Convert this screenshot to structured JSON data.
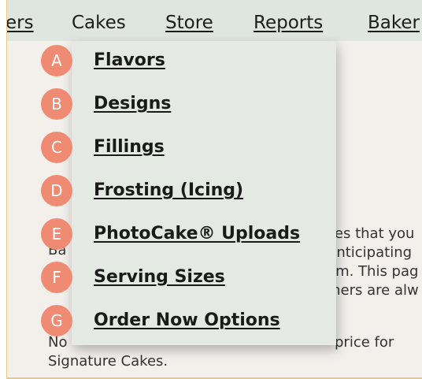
{
  "nav": {
    "items": [
      {
        "label": "ers"
      },
      {
        "label": "Cakes"
      },
      {
        "label": "Store"
      },
      {
        "label": "Reports"
      },
      {
        "label": "Baker"
      }
    ]
  },
  "page": {
    "lines_left": [
      "Ba",
      "",
      "",
      "No",
      "Signature Cakes."
    ],
    "lines_right": [
      "ces that you",
      "Anticipating",
      "em. This pag",
      "mers are alw"
    ],
    "partial_line": "price for"
  },
  "menu": {
    "items": [
      {
        "badge": "A",
        "label": "Flavors"
      },
      {
        "badge": "B",
        "label": "Designs"
      },
      {
        "badge": "C",
        "label": "Fillings"
      },
      {
        "badge": "D",
        "label": "Frosting (Icing)"
      },
      {
        "badge": "E",
        "label": "PhotoCake® Uploads"
      },
      {
        "badge": "F",
        "label": "Serving Sizes"
      },
      {
        "badge": "G",
        "label": "Order Now Options"
      }
    ]
  },
  "colors": {
    "badge": "#ef8b73",
    "nav_bg": "#dfe6df",
    "menu_bg": "#e4e9e3"
  }
}
